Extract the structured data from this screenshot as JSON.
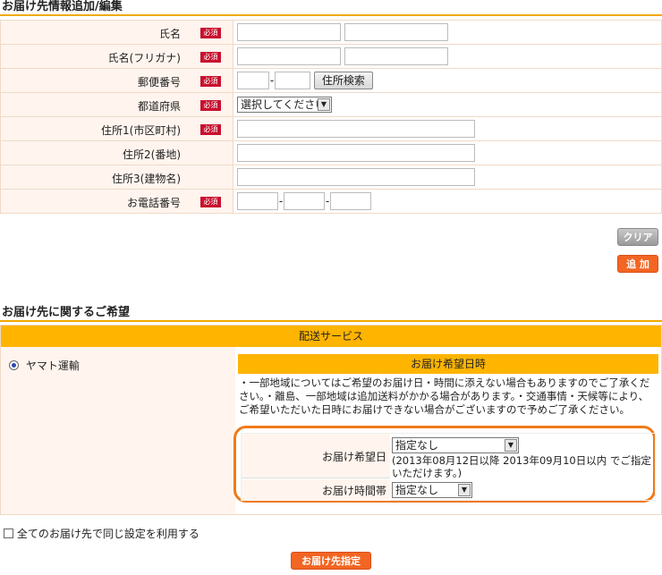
{
  "section1": {
    "title": "お届け先情報追加/編集"
  },
  "required_badge": "必須",
  "fields": {
    "name": {
      "label": "氏名",
      "required": true
    },
    "kana": {
      "label": "氏名(フリガナ)",
      "required": true
    },
    "zip": {
      "label": "郵便番号",
      "required": true,
      "button": "住所検索"
    },
    "pref": {
      "label": "都道府県",
      "required": true,
      "select": "選択してください"
    },
    "addr1": {
      "label": "住所1(市区町村)",
      "required": true
    },
    "addr2": {
      "label": "住所2(番地)",
      "required": false
    },
    "addr3": {
      "label": "住所3(建物名)",
      "required": false
    },
    "phone": {
      "label": "お電話番号",
      "required": true
    }
  },
  "actions": {
    "clear": "クリア",
    "add": "追 加"
  },
  "section2": {
    "title": "お届け先に関するご希望"
  },
  "delivery": {
    "header": "配送サービス",
    "carrier": "ヤマト運輸",
    "date_header": "お届け希望日時",
    "notice": "・一部地域についてはご希望のお届け日・時間に添えない場合もありますのでご了承ください。・離島、一部地域は追加送料がかかる場合があります。・交通事情・天候等により、ご希望いただいた日時にお届けできない場合がございますので予めご了承ください。",
    "date_label": "お届け希望日",
    "date_value": "指定なし",
    "date_note": "(2013年08月12日以降 2013年09月10日以内 でご指定いただけます。)",
    "time_label": "お届け時間帯",
    "time_value": "指定なし"
  },
  "same_setting": "全てのお届け先で同じ設定を利用する",
  "submit": "お届け先指定",
  "colors": {
    "accent": "#f2a900",
    "orange_btn": "#f26522",
    "required": "#c8102e",
    "highlight": "#f07a1a"
  }
}
